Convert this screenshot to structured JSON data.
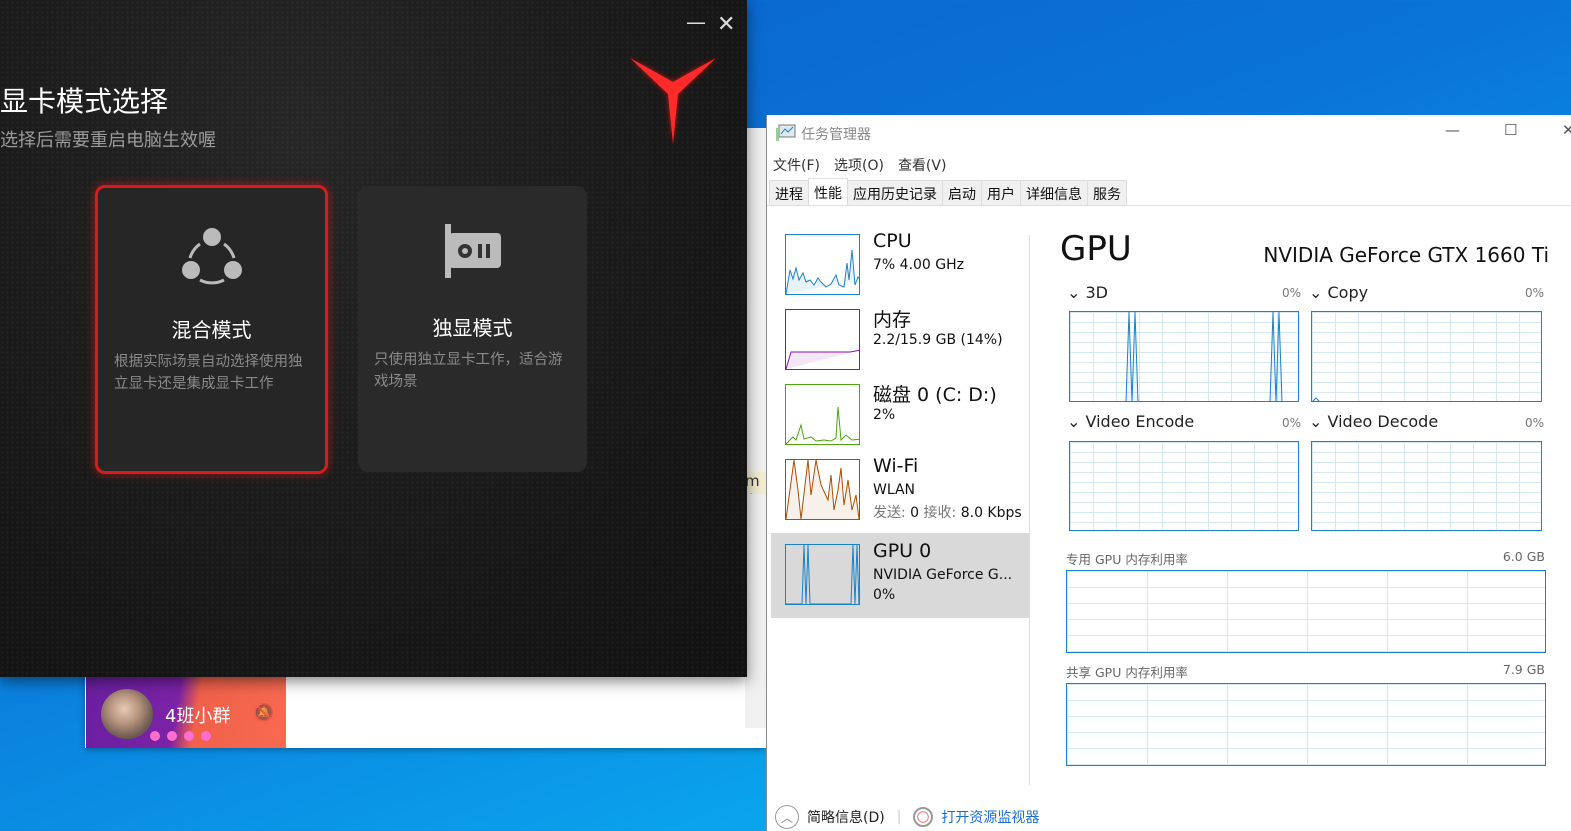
{
  "gpu_mode_window": {
    "title": "显卡模式选择",
    "subtitle": "选择后需要重启电脑生效喔",
    "minimize_icon": "minimize-icon",
    "close_icon": "close-icon",
    "logo": "legion-y-logo",
    "cards": [
      {
        "title": "混合模式",
        "description": "根据实际场景自动选择使用独立显卡还是集成显卡工作",
        "icon": "hybrid-nodes-icon",
        "selected": true
      },
      {
        "title": "独显模式",
        "description": "只使用独立显卡工作，适合游戏场景",
        "icon": "graphics-card-icon",
        "selected": false
      }
    ],
    "accent": "#d41e1e"
  },
  "chat": {
    "group_name": "4班小群",
    "sliver_text": "m在"
  },
  "task_manager": {
    "title": "任务管理器",
    "menu": [
      "文件(F)",
      "选项(O)",
      "查看(V)"
    ],
    "tabs": [
      "进程",
      "性能",
      "应用历史记录",
      "启动",
      "用户",
      "详细信息",
      "服务"
    ],
    "active_tab": "性能",
    "sidebar": [
      {
        "name": "CPU",
        "line1": "7% 4.00 GHz",
        "color": "#1a82c6"
      },
      {
        "name": "内存",
        "line1": "2.2/15.9 GB (14%)",
        "color": "#8b12ae"
      },
      {
        "name": "磁盘 0 (C: D:)",
        "line1": "2%",
        "color": "#4da60c"
      },
      {
        "name": "Wi-Fi",
        "line1": "WLAN",
        "send_label": "发送:",
        "send_value": "0",
        "recv_label": "接收:",
        "recv_value": "8.0 Kbps",
        "color": "#a74f01"
      },
      {
        "name": "GPU 0",
        "line1": "NVIDIA GeForce G...",
        "line2": "0%",
        "color": "#1a82c6",
        "selected": true
      }
    ],
    "detail": {
      "heading": "GPU",
      "model": "NVIDIA GeForce GTX 1660 Ti",
      "engines": [
        {
          "label": "3D",
          "pct": "0%"
        },
        {
          "label": "Copy",
          "pct": "0%"
        },
        {
          "label": "Video Encode",
          "pct": "0%"
        },
        {
          "label": "Video Decode",
          "pct": "0%"
        }
      ],
      "dedicated_label": "专用 GPU 内存利用率",
      "dedicated_max": "6.0 GB",
      "shared_label": "共享 GPU 内存利用率",
      "shared_max": "7.9 GB"
    },
    "footer": {
      "fewer_details": "简略信息(D)",
      "open_monitor": "打开资源监视器"
    }
  }
}
